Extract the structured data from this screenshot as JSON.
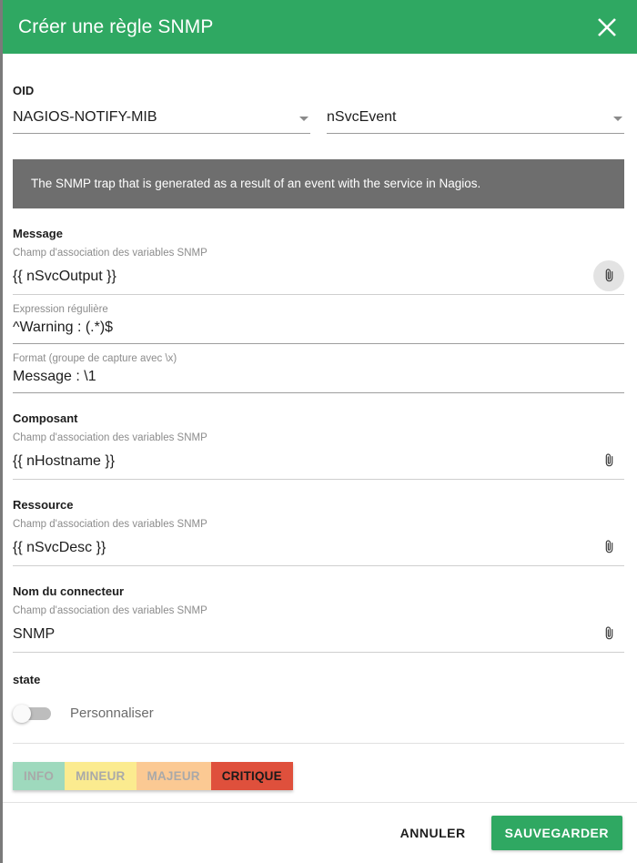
{
  "dialog": {
    "title": "Créer une règle SNMP",
    "close_icon": "close-icon",
    "accent_color": "#2fa862"
  },
  "oid": {
    "label": "OID",
    "mib_value": "NAGIOS-NOTIFY-MIB",
    "trap_value": "nSvcEvent",
    "caret_icon": "chevron-down-icon"
  },
  "info_banner": {
    "text": "The SNMP trap that is generated as a result of an event with the service in Nagios.",
    "background_color": "#6e6e6e"
  },
  "message": {
    "title": "Message",
    "hint": "Champ d'association des variables SNMP",
    "value": "{{ nSvcOutput }}",
    "clip_icon": "attachment-icon",
    "regex": {
      "hint": "Expression régulière",
      "value": "^Warning : (.*)$"
    },
    "format": {
      "hint": "Format (groupe de capture avec \\x)",
      "value": "Message : \\1"
    }
  },
  "composant": {
    "title": "Composant",
    "hint": "Champ d'association des variables SNMP",
    "value": "{{ nHostname }}",
    "clip_icon": "attachment-icon"
  },
  "ressource": {
    "title": "Ressource",
    "hint": "Champ d'association des variables SNMP",
    "value": "{{ nSvcDesc }}",
    "clip_icon": "attachment-icon"
  },
  "connecteur": {
    "title": "Nom du connecteur",
    "hint": "Champ d'association des variables SNMP",
    "value": "SNMP",
    "clip_icon": "attachment-icon"
  },
  "state": {
    "title": "state",
    "toggle_label": "Personnaliser",
    "toggle_on": false,
    "severities": [
      {
        "label": "INFO",
        "color": "#9ed9bd",
        "selected": false
      },
      {
        "label": "MINEUR",
        "color": "#fbeb8f",
        "selected": false
      },
      {
        "label": "MAJEUR",
        "color": "#fbc993",
        "selected": false
      },
      {
        "label": "CRITIQUE",
        "color": "#df503c",
        "selected": true
      }
    ]
  },
  "footer": {
    "cancel_label": "ANNULER",
    "save_label": "SAUVEGARDER"
  }
}
